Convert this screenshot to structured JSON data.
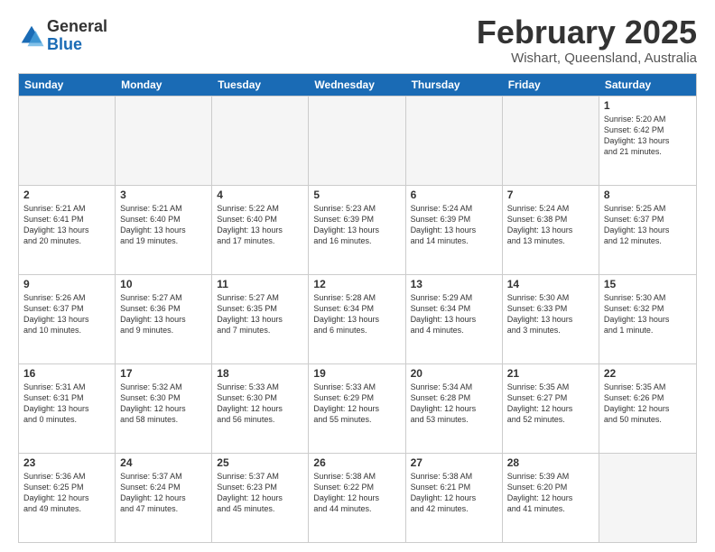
{
  "logo": {
    "general": "General",
    "blue": "Blue"
  },
  "title": "February 2025",
  "location": "Wishart, Queensland, Australia",
  "days_of_week": [
    "Sunday",
    "Monday",
    "Tuesday",
    "Wednesday",
    "Thursday",
    "Friday",
    "Saturday"
  ],
  "weeks": [
    [
      {
        "day": "",
        "info": ""
      },
      {
        "day": "",
        "info": ""
      },
      {
        "day": "",
        "info": ""
      },
      {
        "day": "",
        "info": ""
      },
      {
        "day": "",
        "info": ""
      },
      {
        "day": "",
        "info": ""
      },
      {
        "day": "1",
        "info": "Sunrise: 5:20 AM\nSunset: 6:42 PM\nDaylight: 13 hours\nand 21 minutes."
      }
    ],
    [
      {
        "day": "2",
        "info": "Sunrise: 5:21 AM\nSunset: 6:41 PM\nDaylight: 13 hours\nand 20 minutes."
      },
      {
        "day": "3",
        "info": "Sunrise: 5:21 AM\nSunset: 6:40 PM\nDaylight: 13 hours\nand 19 minutes."
      },
      {
        "day": "4",
        "info": "Sunrise: 5:22 AM\nSunset: 6:40 PM\nDaylight: 13 hours\nand 17 minutes."
      },
      {
        "day": "5",
        "info": "Sunrise: 5:23 AM\nSunset: 6:39 PM\nDaylight: 13 hours\nand 16 minutes."
      },
      {
        "day": "6",
        "info": "Sunrise: 5:24 AM\nSunset: 6:39 PM\nDaylight: 13 hours\nand 14 minutes."
      },
      {
        "day": "7",
        "info": "Sunrise: 5:24 AM\nSunset: 6:38 PM\nDaylight: 13 hours\nand 13 minutes."
      },
      {
        "day": "8",
        "info": "Sunrise: 5:25 AM\nSunset: 6:37 PM\nDaylight: 13 hours\nand 12 minutes."
      }
    ],
    [
      {
        "day": "9",
        "info": "Sunrise: 5:26 AM\nSunset: 6:37 PM\nDaylight: 13 hours\nand 10 minutes."
      },
      {
        "day": "10",
        "info": "Sunrise: 5:27 AM\nSunset: 6:36 PM\nDaylight: 13 hours\nand 9 minutes."
      },
      {
        "day": "11",
        "info": "Sunrise: 5:27 AM\nSunset: 6:35 PM\nDaylight: 13 hours\nand 7 minutes."
      },
      {
        "day": "12",
        "info": "Sunrise: 5:28 AM\nSunset: 6:34 PM\nDaylight: 13 hours\nand 6 minutes."
      },
      {
        "day": "13",
        "info": "Sunrise: 5:29 AM\nSunset: 6:34 PM\nDaylight: 13 hours\nand 4 minutes."
      },
      {
        "day": "14",
        "info": "Sunrise: 5:30 AM\nSunset: 6:33 PM\nDaylight: 13 hours\nand 3 minutes."
      },
      {
        "day": "15",
        "info": "Sunrise: 5:30 AM\nSunset: 6:32 PM\nDaylight: 13 hours\nand 1 minute."
      }
    ],
    [
      {
        "day": "16",
        "info": "Sunrise: 5:31 AM\nSunset: 6:31 PM\nDaylight: 13 hours\nand 0 minutes."
      },
      {
        "day": "17",
        "info": "Sunrise: 5:32 AM\nSunset: 6:30 PM\nDaylight: 12 hours\nand 58 minutes."
      },
      {
        "day": "18",
        "info": "Sunrise: 5:33 AM\nSunset: 6:30 PM\nDaylight: 12 hours\nand 56 minutes."
      },
      {
        "day": "19",
        "info": "Sunrise: 5:33 AM\nSunset: 6:29 PM\nDaylight: 12 hours\nand 55 minutes."
      },
      {
        "day": "20",
        "info": "Sunrise: 5:34 AM\nSunset: 6:28 PM\nDaylight: 12 hours\nand 53 minutes."
      },
      {
        "day": "21",
        "info": "Sunrise: 5:35 AM\nSunset: 6:27 PM\nDaylight: 12 hours\nand 52 minutes."
      },
      {
        "day": "22",
        "info": "Sunrise: 5:35 AM\nSunset: 6:26 PM\nDaylight: 12 hours\nand 50 minutes."
      }
    ],
    [
      {
        "day": "23",
        "info": "Sunrise: 5:36 AM\nSunset: 6:25 PM\nDaylight: 12 hours\nand 49 minutes."
      },
      {
        "day": "24",
        "info": "Sunrise: 5:37 AM\nSunset: 6:24 PM\nDaylight: 12 hours\nand 47 minutes."
      },
      {
        "day": "25",
        "info": "Sunrise: 5:37 AM\nSunset: 6:23 PM\nDaylight: 12 hours\nand 45 minutes."
      },
      {
        "day": "26",
        "info": "Sunrise: 5:38 AM\nSunset: 6:22 PM\nDaylight: 12 hours\nand 44 minutes."
      },
      {
        "day": "27",
        "info": "Sunrise: 5:38 AM\nSunset: 6:21 PM\nDaylight: 12 hours\nand 42 minutes."
      },
      {
        "day": "28",
        "info": "Sunrise: 5:39 AM\nSunset: 6:20 PM\nDaylight: 12 hours\nand 41 minutes."
      },
      {
        "day": "",
        "info": ""
      }
    ]
  ]
}
